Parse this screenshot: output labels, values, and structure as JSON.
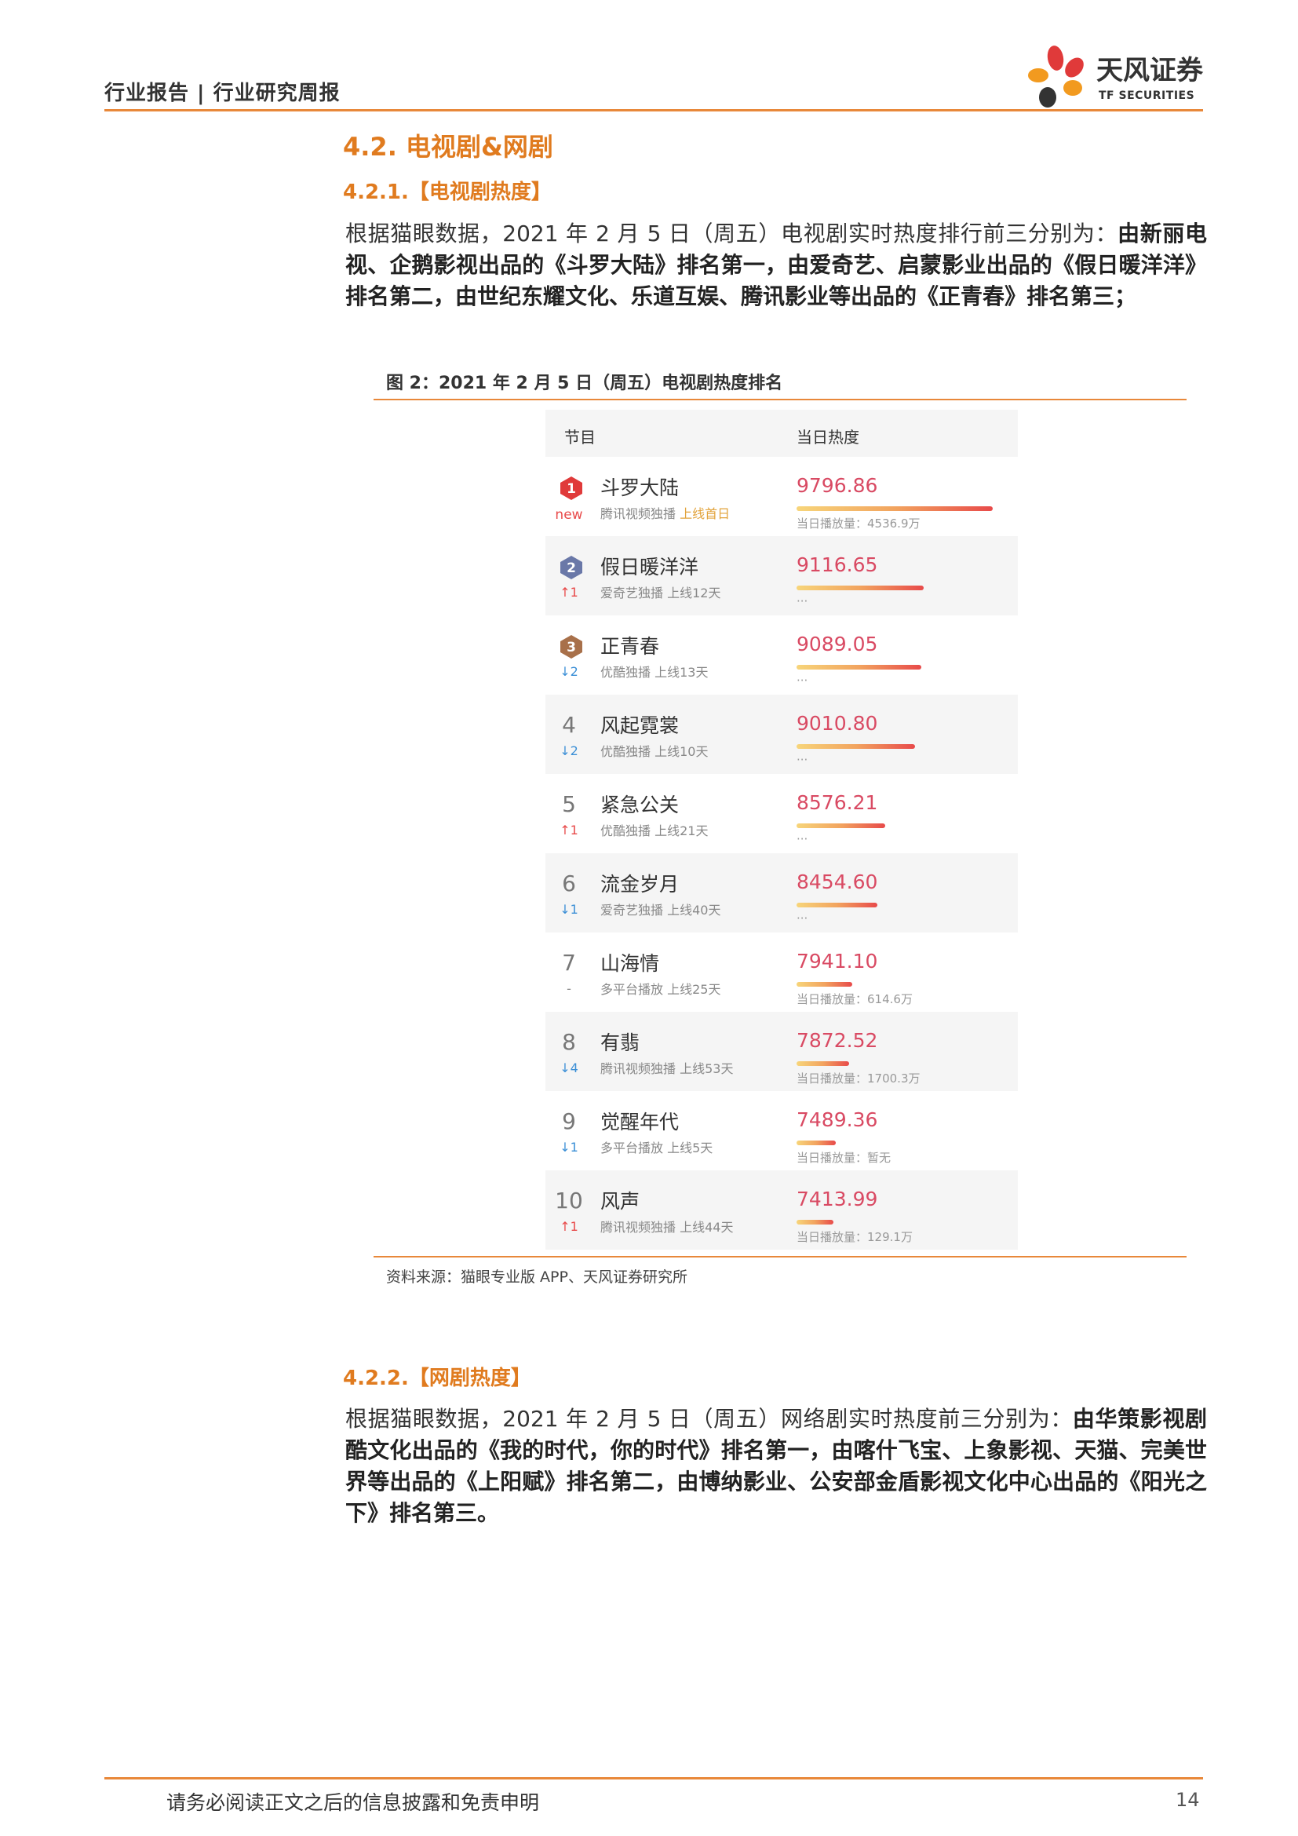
{
  "header": {
    "breadcrumb": "行业报告 | 行业研究周报"
  },
  "logo": {
    "name": "天风证券",
    "sub": "TF SECURITIES"
  },
  "section": {
    "heading": "4.2. 电视剧&网剧",
    "tv": {
      "heading": "4.2.1.【电视剧热度】",
      "para_plain": "根据猫眼数据，2021 年 2 月 5 日（周五）电视剧实时热度排行前三分别为：",
      "para_bold": "由新丽电视、企鹅影视出品的《斗罗大陆》排名第一，由爱奇艺、启蒙影业出品的《假日暖洋洋》排名第二，由世纪东耀文化、乐道互娱、腾讯影业等出品的《正青春》排名第三；"
    },
    "web": {
      "heading": "4.2.2.【网剧热度】",
      "para_plain": "根据猫眼数据，2021 年 2 月 5 日（周五）网络剧实时热度前三分别为：",
      "para_bold": "由华策影视剧酷文化出品的《我的时代，你的时代》排名第一，由喀什飞宝、上象影视、天猫、完美世界等出品的《上阳赋》排名第二，由博纳影业、公安部金盾影视文化中心出品的《阳光之下》排名第三。"
    }
  },
  "figure": {
    "title": "图 2：2021 年 2 月 5 日（周五）电视剧热度排名",
    "source": "资料来源：猫眼专业版 APP、天风证券研究所",
    "columns": [
      "节目",
      "当日热度"
    ],
    "max_heat": 9796.86,
    "rows": [
      {
        "rank": "1",
        "badge_color": "#e03a3a",
        "change": "new",
        "change_dir": "new",
        "title": "斗罗大陆",
        "platform": "腾讯视频独播",
        "status": "上线首日",
        "status_highlight": true,
        "heat": "9796.86",
        "heat_value": 9796.86,
        "play": "当日播放量：4536.9万"
      },
      {
        "rank": "2",
        "badge_color": "#6a78a8",
        "change": "↑1",
        "change_dir": "up",
        "title": "假日暖洋洋",
        "platform": "爱奇艺独播",
        "status": "上线12天",
        "status_highlight": false,
        "heat": "9116.65",
        "heat_value": 9116.65,
        "play": "···"
      },
      {
        "rank": "3",
        "badge_color": "#a8704a",
        "change": "↓2",
        "change_dir": "down",
        "title": "正青春",
        "platform": "优酷独播",
        "status": "上线13天",
        "status_highlight": false,
        "heat": "9089.05",
        "heat_value": 9089.05,
        "play": "···"
      },
      {
        "rank": "4",
        "badge_color": "",
        "change": "↓2",
        "change_dir": "down",
        "title": "风起霓裳",
        "platform": "优酷独播",
        "status": "上线10天",
        "status_highlight": false,
        "heat": "9010.80",
        "heat_value": 9010.8,
        "play": "···"
      },
      {
        "rank": "5",
        "badge_color": "",
        "change": "↑1",
        "change_dir": "up",
        "title": "紧急公关",
        "platform": "优酷独播",
        "status": "上线21天",
        "status_highlight": false,
        "heat": "8576.21",
        "heat_value": 8576.21,
        "play": "···"
      },
      {
        "rank": "6",
        "badge_color": "",
        "change": "↓1",
        "change_dir": "down",
        "title": "流金岁月",
        "platform": "爱奇艺独播",
        "status": "上线40天",
        "status_highlight": false,
        "heat": "8454.60",
        "heat_value": 8454.6,
        "play": "···"
      },
      {
        "rank": "7",
        "badge_color": "",
        "change": "-",
        "change_dir": "same",
        "title": "山海情",
        "platform": "多平台播放",
        "status": "上线25天",
        "status_highlight": false,
        "heat": "7941.10",
        "heat_value": 7941.1,
        "play": "当日播放量：614.6万"
      },
      {
        "rank": "8",
        "badge_color": "",
        "change": "↓4",
        "change_dir": "down",
        "title": "有翡",
        "platform": "腾讯视频独播",
        "status": "上线53天",
        "status_highlight": false,
        "heat": "7872.52",
        "heat_value": 7872.52,
        "play": "当日播放量：1700.3万"
      },
      {
        "rank": "9",
        "badge_color": "",
        "change": "↓1",
        "change_dir": "down",
        "title": "觉醒年代",
        "platform": "多平台播放",
        "status": "上线5天",
        "status_highlight": false,
        "heat": "7489.36",
        "heat_value": 7489.36,
        "play": "当日播放量：暂无"
      },
      {
        "rank": "10",
        "badge_color": "",
        "change": "↑1",
        "change_dir": "up",
        "title": "风声",
        "platform": "腾讯视频独播",
        "status": "上线44天",
        "status_highlight": false,
        "heat": "7413.99",
        "heat_value": 7413.99,
        "play": "当日播放量：129.1万"
      }
    ]
  },
  "footer": {
    "disclaimer": "请务必阅读正文之后的信息披露和免责申明",
    "page": "14"
  }
}
